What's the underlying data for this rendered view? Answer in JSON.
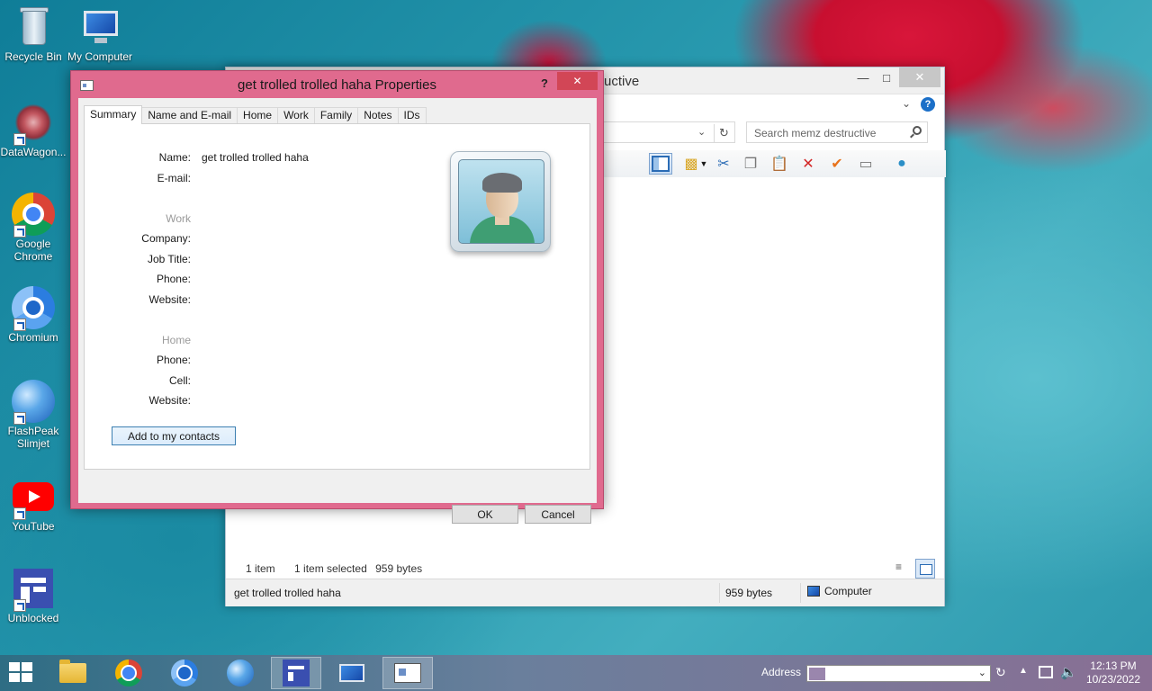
{
  "desktop": {
    "icons": [
      {
        "label": "Recycle Bin",
        "icon": "recycle-bin-icon"
      },
      {
        "label": "My Computer",
        "icon": "my-computer-icon"
      },
      {
        "label": "DataWagon...",
        "icon": "datawagon-icon"
      },
      {
        "label": "Google Chrome",
        "icon": "chrome-icon"
      },
      {
        "label": "Chromium",
        "icon": "chromium-icon"
      },
      {
        "label": "FlashPeak Slimjet",
        "icon": "slimjet-icon"
      },
      {
        "label": "YouTube",
        "icon": "youtube-icon"
      },
      {
        "label": "Unblocked",
        "icon": "unblocked-icon"
      }
    ]
  },
  "explorer": {
    "title_partial": "uctive",
    "search_placeholder": "Search memz destructive",
    "status": {
      "items": "1 item",
      "selected": "1 item selected",
      "size": "959 bytes"
    },
    "bottom": {
      "filename": "get trolled trolled haha",
      "size": "959 bytes",
      "zone": "Computer"
    }
  },
  "dialog": {
    "title": "get trolled trolled haha Properties",
    "help_label": "?",
    "close_label": "✕",
    "tabs": [
      {
        "label": "Summary",
        "active": true
      },
      {
        "label": "Name and E-mail",
        "active": false
      },
      {
        "label": "Home",
        "active": false
      },
      {
        "label": "Work",
        "active": false
      },
      {
        "label": "Family",
        "active": false
      },
      {
        "label": "Notes",
        "active": false
      },
      {
        "label": "IDs",
        "active": false
      }
    ],
    "summary": {
      "name_label": "Name:",
      "name_value": "get trolled trolled haha",
      "email_label": "E-mail:",
      "work_heading": "Work",
      "company_label": "Company:",
      "job_title_label": "Job Title:",
      "work_phone_label": "Phone:",
      "work_website_label": "Website:",
      "home_heading": "Home",
      "home_phone_label": "Phone:",
      "cell_label": "Cell:",
      "home_website_label": "Website:",
      "add_button": "Add to my contacts"
    },
    "ok_button": "OK",
    "cancel_button": "Cancel"
  },
  "taskbar": {
    "address_label": "Address",
    "clock_time": "12:13 PM",
    "clock_date": "10/23/2022",
    "items": [
      "file-explorer",
      "google-chrome",
      "chromium",
      "slimjet",
      "unblocked",
      "my-computer",
      "contact-properties"
    ]
  }
}
